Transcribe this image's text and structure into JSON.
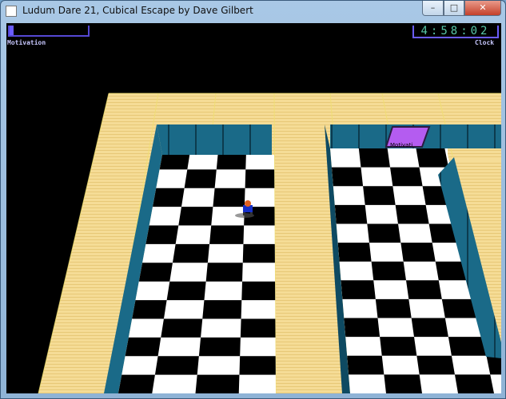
{
  "window": {
    "title": "Ludum Dare 21, Cubical Escape by Dave Gilbert",
    "buttons": {
      "minimize": "–",
      "maximize": "□",
      "close": "✕"
    }
  },
  "hud": {
    "motivation_label": "Motivation",
    "motivation_level": 0.05,
    "clock_label": "Clock",
    "clock_value": "4:58:02"
  },
  "scene": {
    "pickup_label": "Motivati",
    "colors": {
      "floor_cream": "#f5dc96",
      "wall_teal": "#1c6f8f",
      "checker_dark": "#000000",
      "checker_light": "#ffffff",
      "pickup_purple": "#b45cf0",
      "hud_blue": "#6a5cff"
    }
  }
}
